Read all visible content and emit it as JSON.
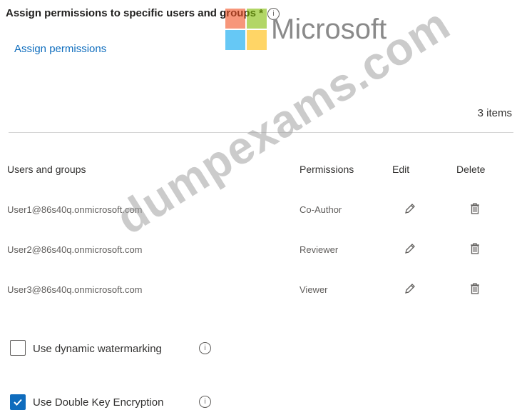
{
  "header": {
    "title": "Assign permissions to specific users and groups *",
    "info_glyph": "i",
    "assign_link": "Assign permissions"
  },
  "list": {
    "count_label": "3 items",
    "columns": {
      "users": "Users and groups",
      "permissions": "Permissions",
      "edit": "Edit",
      "delete": "Delete"
    },
    "rows": [
      {
        "user": "User1@86s40q.onmicrosoft.com",
        "permission": "Co-Author"
      },
      {
        "user": "User2@86s40q.onmicrosoft.com",
        "permission": "Reviewer"
      },
      {
        "user": "User3@86s40q.onmicrosoft.com",
        "permission": "Viewer"
      }
    ]
  },
  "options": {
    "dynamic_watermarking": {
      "label": "Use dynamic watermarking",
      "checked": false
    },
    "double_key_encryption": {
      "label": "Use Double Key Encryption",
      "checked": true
    }
  },
  "overlay": {
    "logo_text": "Microsoft",
    "watermark_text": "dumpexams.com"
  },
  "colors": {
    "accent": "#0f6cbd",
    "link": "#106ebe",
    "logo_red": "#f25022",
    "logo_green": "#7fba00",
    "logo_blue": "#00a4ef",
    "logo_yellow": "#ffb900"
  },
  "icons": {
    "edit": "pencil-icon",
    "delete": "trash-icon",
    "info": "info-icon",
    "check": "checkmark-icon"
  }
}
